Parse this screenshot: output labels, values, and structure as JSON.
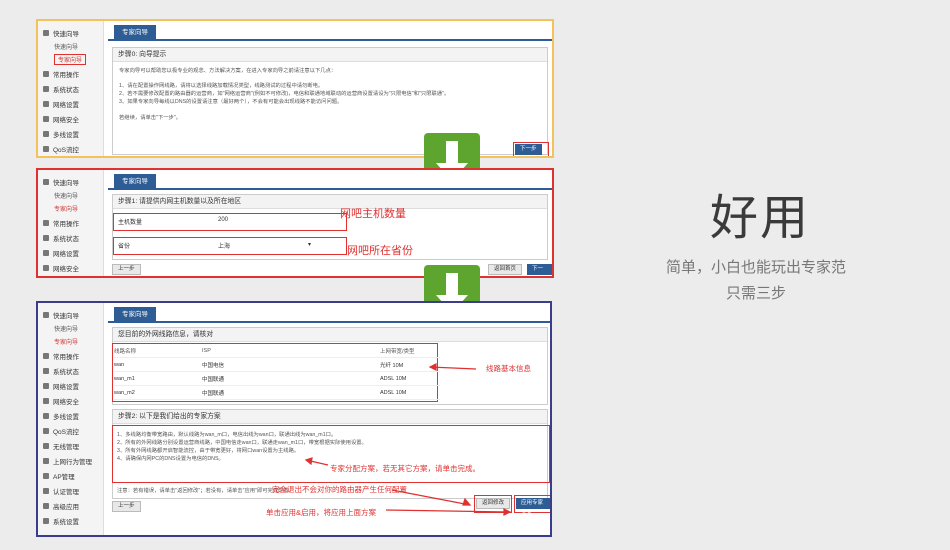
{
  "sidebar": {
    "quick_wizard": "快速向导",
    "sub_wizard": "快速向导",
    "sub_expert": "专家向导",
    "items": [
      "常用操作",
      "系统状态",
      "网络设置",
      "网络安全",
      "多线设置",
      "QoS流控",
      "无线管理",
      "上网行为管理",
      "AP管理",
      "认证管理",
      "高级应用",
      "系统设置"
    ]
  },
  "panel1": {
    "tab": "专家向导",
    "header": "步骤0: 向导提示",
    "intro": "专家向导可以帮助您以极专业的观念、方法解决方案，在进入专家向导之前请注意以下几点：",
    "lines": [
      "1、请在配置操作网线路，请将以选择线路加载情况类型，线路测试的过程中请勿断电。",
      "2、若不需要修改配置的路由器的运营商，如\"网络运营商\"(例如不可修改)，电信和联通地域联动的运营商设置请设为\"只限电信\"和\"只限联通\"。",
      "3、如果专家向导每线以DNS的设置请注意（最好两个），不会有可能会出现线路不能访问问题。"
    ],
    "confirm": "若继续，请单击\"下一步\"。",
    "next_btn": "下一步"
  },
  "panel2": {
    "tab": "专家向导",
    "header": "步骤1: 请提供内网主机数量以及所在地区",
    "host_label": "主机数量",
    "host_value": "200",
    "province_label": "省份",
    "province_value": "上海",
    "prev_btn": "上一步",
    "back_btn": "返回首页",
    "next_btn": "下一步"
  },
  "panel3": {
    "tab": "专家向导",
    "header1": "您目前的外网线路信息，请核对",
    "cols": [
      "线路名称",
      "ISP",
      "上网带宽/类型"
    ],
    "rows": [
      [
        "wan",
        "中国电信",
        "光纤 10M"
      ],
      [
        "wan_m1",
        "中国联通",
        "ADSL 10M"
      ],
      [
        "wan_m2",
        "中国联通",
        "ADSL 10M"
      ]
    ],
    "header2": "步骤2: 以下是我们给出的专家方案",
    "plan": [
      "1、多线路均衡带宽路由，默认线路为wan_m口，电信出线为wan口，联通出线为wan_m1口。",
      "2、所有的外网线路分别设置运营商线路，中国电信走wan口，联通走wan_m1口，带宽根据实际使用设置。",
      "3、所有外网线路都开启智能流控，由于带宽更好，将网口wan设置为主线路。",
      "4、请确保内网PC的DNS设置为电信的DNS。"
    ],
    "tip": "注意：若有错误，请单击\"返回修改\"；若没有，请单击\"应用\"即可完成配置。",
    "prev_btn": "上一步",
    "back_btn": "返回修改",
    "apply_btn": "应用专家方案"
  },
  "annotations": {
    "host_count": "网吧主机数量",
    "province": "网吧所在省份",
    "line_info": "线路基本信息",
    "expert_plan": "专家分配方案，若无其它方案，请单击完成。",
    "safe": "完全退出不会对你的路由器产生任何配置",
    "apply": "单击应用&启用，将应用上面方案"
  },
  "hero": {
    "title": "好用",
    "subtitle": "简单，小白也能玩出专家范",
    "subtitle2": "只需三步"
  },
  "colors": {
    "accent": "#2e5d95",
    "annotation": "#e03030",
    "arrow": "#5ea52f"
  }
}
